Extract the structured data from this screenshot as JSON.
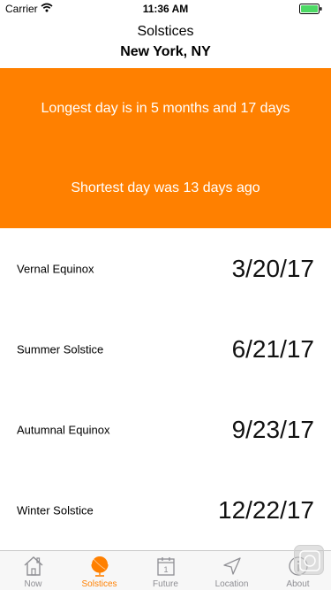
{
  "status_bar": {
    "carrier": "Carrier",
    "time": "11:36 AM",
    "icons": [
      "wifi-icon",
      "battery-icon"
    ]
  },
  "header": {
    "title": "Solstices",
    "location": "New York, NY"
  },
  "banner": {
    "color": "#ff8000",
    "longest": "Longest day is in 5 months and 17 days",
    "shortest": "Shortest day was 13 days ago"
  },
  "events": [
    {
      "label": "Vernal Equinox",
      "date": "3/20/17"
    },
    {
      "label": "Summer Solstice",
      "date": "6/21/17"
    },
    {
      "label": "Autumnal Equinox",
      "date": "9/23/17"
    },
    {
      "label": "Winter Solstice",
      "date": "12/22/17"
    }
  ],
  "tabs": [
    {
      "label": "Now",
      "icon": "house-icon",
      "active": false
    },
    {
      "label": "Solstices",
      "icon": "globe-icon",
      "active": true
    },
    {
      "label": "Future",
      "icon": "calendar-icon",
      "active": false
    },
    {
      "label": "Location",
      "icon": "location-arrow-icon",
      "active": false
    },
    {
      "label": "About",
      "icon": "info-icon",
      "active": false
    }
  ],
  "calendar_icon_day": "1",
  "accent_color": "#ff8000",
  "inactive_color": "#8e8e93"
}
